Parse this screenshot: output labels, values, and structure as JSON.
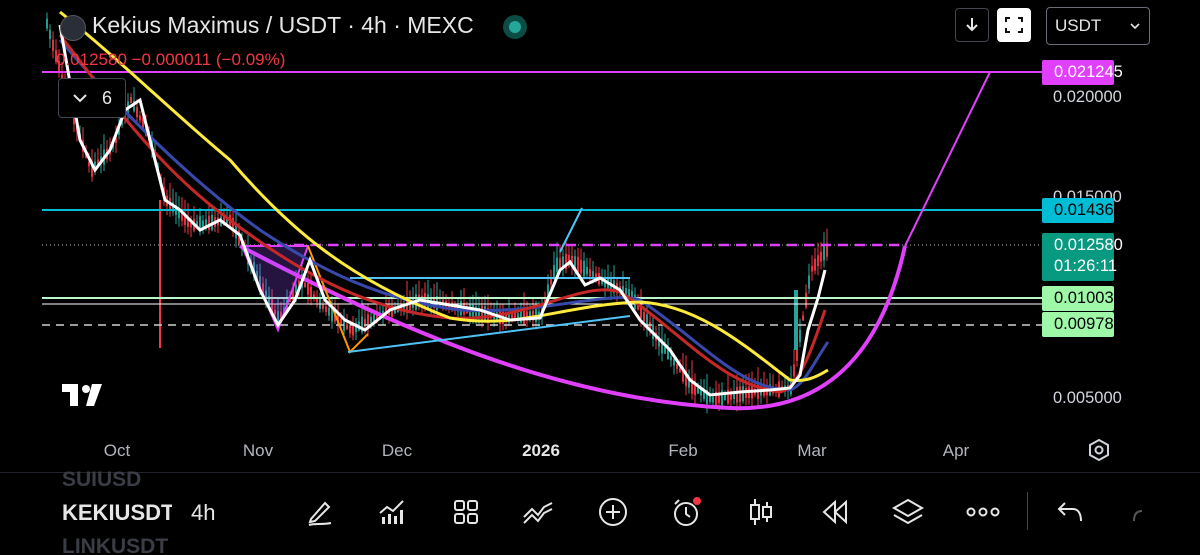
{
  "header": {
    "title": "Kekius Maximus / USDT · 4h · MEXC",
    "ohlc_text": "0.012580  −0.000011  (−0.09%)",
    "indicators_count": "6"
  },
  "toolbar": {
    "currency": "USDT"
  },
  "price_axis": {
    "labels": [
      "0.020000",
      "0.015000",
      "0.005000"
    ],
    "tags": {
      "pink": "0.021245",
      "cyan": "0.014361",
      "last_price": "0.012580",
      "countdown": "01:26:11",
      "green_a": "0.010039",
      "green_b": "0.009784"
    }
  },
  "time_axis": {
    "labels": [
      "Oct",
      "Nov",
      "Dec",
      "2026",
      "Feb",
      "Mar",
      "Apr"
    ]
  },
  "bottom": {
    "symbol_prev": "SUIUSD",
    "symbol": "KEKIUSDT",
    "symbol_next": "LINKUSDT",
    "timeframe": "4h"
  },
  "colors": {
    "up": "#26a69a",
    "down": "#f23645",
    "pink": "#e040fb",
    "cyan": "#00bcd4",
    "green_tag": "#9ff7a8",
    "ma_yellow": "#ffeb3b",
    "ma_white": "#ffffff",
    "ma_red": "#d32f2f",
    "ma_blue": "#3f51b5"
  },
  "icons": [
    "download-icon",
    "fullscreen-icon",
    "chevron-down-icon",
    "pencil-icon",
    "indicators-icon",
    "templates-icon",
    "compare-icon",
    "add-icon",
    "alert-icon",
    "candles-icon",
    "replay-icon",
    "layers-icon",
    "more-icon",
    "undo-icon",
    "tradingview-logo"
  ]
}
